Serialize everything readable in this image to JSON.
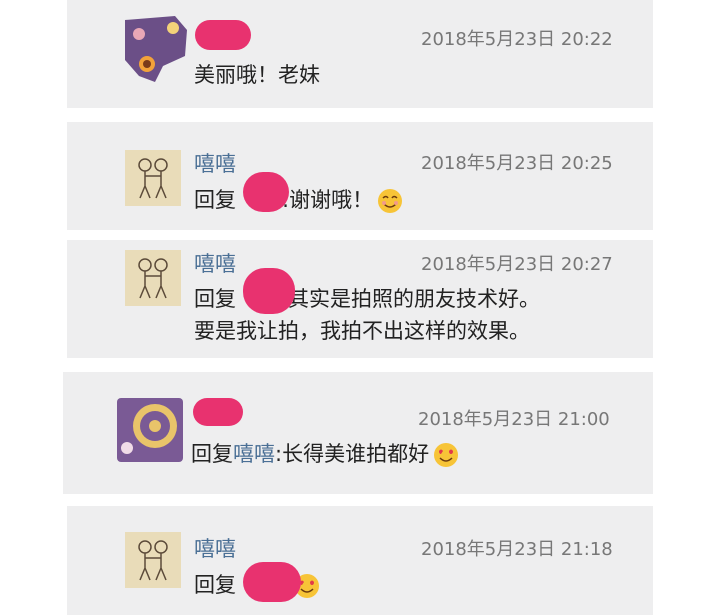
{
  "comments": [
    {
      "time": "2018年5月23日 20:22",
      "text": "美丽哦！老妹"
    },
    {
      "name": "嘻嘻",
      "time": "2018年5月23日 20:25",
      "reply_prefix": "回复",
      "text": ":谢谢哦！",
      "emoji": "smile-blush-icon"
    },
    {
      "name": "嘻嘻",
      "time": "2018年5月23日 20:27",
      "reply_prefix": "回复",
      "text_line1": "其实是拍照的朋友技术好。",
      "text_line2": "要是我让拍，我拍不出这样的效果。"
    },
    {
      "time": "2018年5月23日 21:00",
      "reply_prefix": "回复",
      "reply_target": "嘻嘻",
      "text": ":长得美谁拍都好",
      "emoji": "heart-eyes-icon"
    },
    {
      "name": "嘻嘻",
      "time": "2018年5月23日 21:18",
      "reply_prefix": "回复",
      "emoji": "heart-eyes-icon"
    }
  ],
  "colors": {
    "card_bg": "#eeeeef",
    "name": "#4a6f95",
    "redaction": "#e8326f"
  }
}
